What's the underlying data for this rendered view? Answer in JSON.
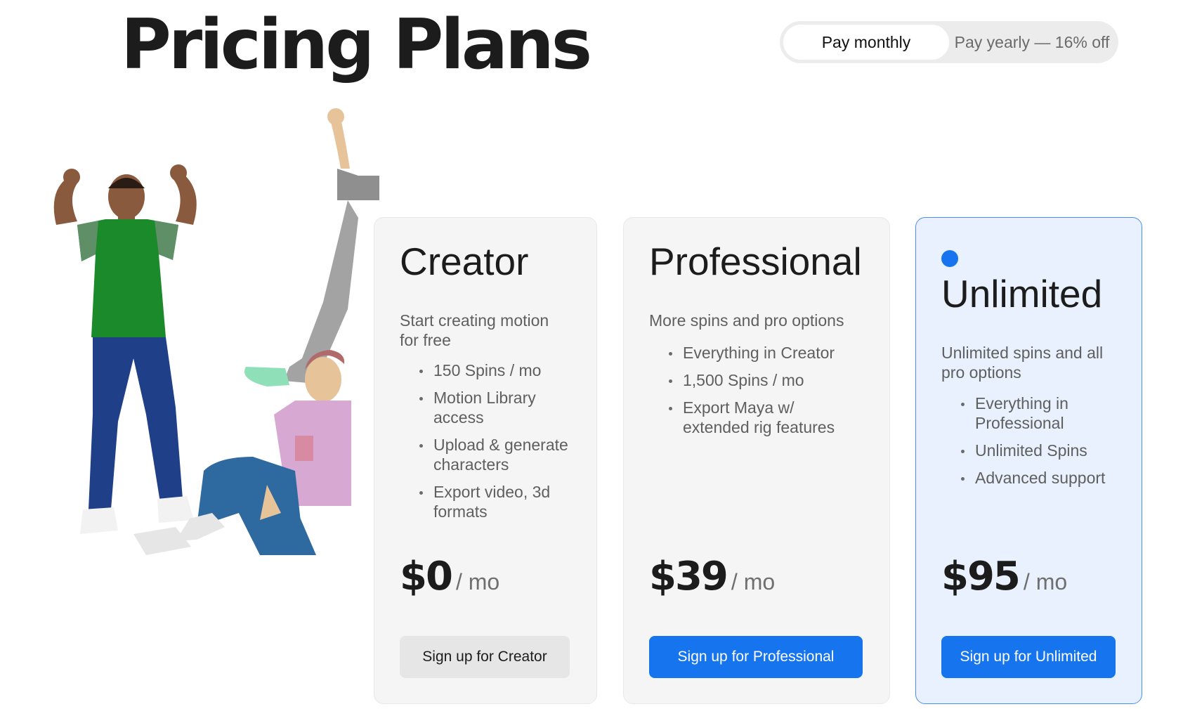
{
  "page": {
    "title": "Pricing Plans"
  },
  "billing_toggle": {
    "monthly_label": "Pay monthly",
    "yearly_label": "Pay yearly — 16% off",
    "selected": "monthly"
  },
  "colors": {
    "accent": "#1675ee",
    "highlight_bg": "#e8f1fd",
    "card_bg": "#f5f5f5"
  },
  "plans": [
    {
      "name": "Creator",
      "description": "Start creating motion for free",
      "features": [
        "150 Spins / mo",
        "Motion Library access",
        "Upload & generate characters",
        "Export video, 3d formats"
      ],
      "price": "$0",
      "period": "/ mo",
      "cta": "Sign up for Creator"
    },
    {
      "name": "Professional",
      "description": "More spins and pro options",
      "features": [
        "Everything in Creator",
        "1,500 Spins / mo",
        "Export Maya w/ extended rig features"
      ],
      "price": "$39",
      "period": "/ mo",
      "cta": "Sign up for Professional"
    },
    {
      "name": "Unlimited",
      "description": "Unlimited spins and all pro options",
      "features": [
        "Everything in Professional",
        "Unlimited Spins",
        "Advanced support"
      ],
      "price": "$95",
      "period": "/ mo",
      "cta": "Sign up for Unlimited"
    }
  ]
}
